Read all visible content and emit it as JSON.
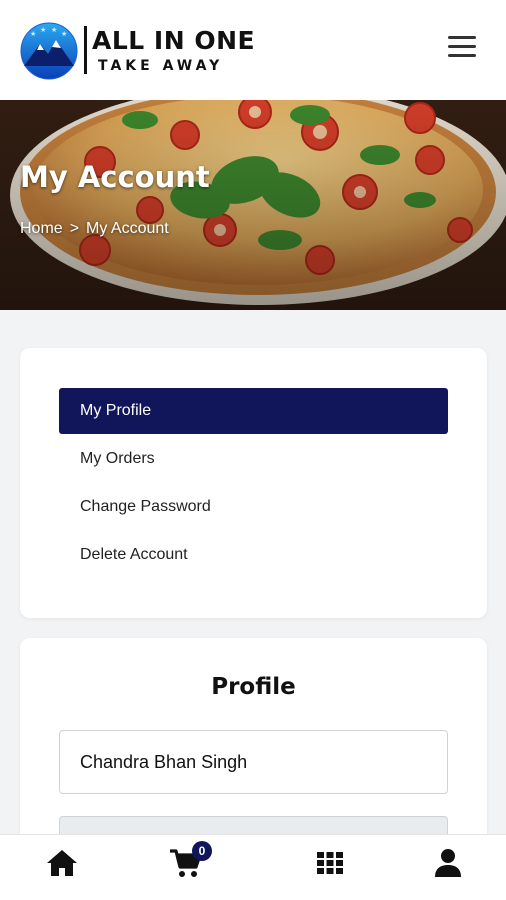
{
  "brand": {
    "title": "ALL IN ONE",
    "subtitle": "TAKE AWAY"
  },
  "banner": {
    "title": "My Account",
    "breadcrumb": {
      "home": "Home",
      "separator": ">",
      "current": "My Account"
    }
  },
  "account_menu": {
    "items": [
      {
        "label": "My Profile",
        "active": true
      },
      {
        "label": "My Orders",
        "active": false
      },
      {
        "label": "Change Password",
        "active": false
      },
      {
        "label": "Delete Account",
        "active": false
      }
    ]
  },
  "profile": {
    "title": "Profile",
    "name_value": "Chandra Bhan Singh",
    "second_value": ""
  },
  "bottom_nav": {
    "items": [
      {
        "icon": "home-icon"
      },
      {
        "icon": "cart-icon",
        "badge": "0"
      },
      {
        "icon": "grid-icon"
      },
      {
        "icon": "user-icon"
      }
    ]
  },
  "colors": {
    "accent": "#101659",
    "header_bg": "#ffffff",
    "page_bg": "#f2f3f5"
  }
}
